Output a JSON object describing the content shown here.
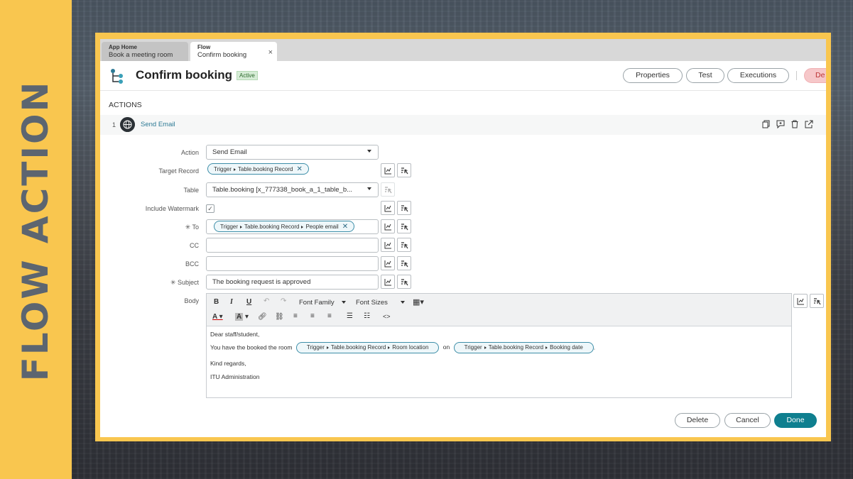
{
  "banner": {
    "text": "FLOW ACTION"
  },
  "tabs": [
    {
      "app": "App Home",
      "label": "Book a meeting room"
    },
    {
      "app": "Flow",
      "label": "Confirm booking",
      "close": "×"
    }
  ],
  "header": {
    "title": "Confirm booking",
    "status": "Active",
    "buttons": {
      "properties": "Properties",
      "test": "Test",
      "executions": "Executions",
      "delete": "De"
    }
  },
  "actions": {
    "section_label": "ACTIONS",
    "number": "1",
    "name": "Send Email",
    "row_icons": [
      "copy-icon",
      "comment-icon",
      "trash-icon",
      "open-external-icon"
    ]
  },
  "form": {
    "action": {
      "label": "Action",
      "value": "Send Email"
    },
    "target_record": {
      "label": "Target Record",
      "pill": [
        "Trigger",
        "Table.booking Record"
      ]
    },
    "table": {
      "label": "Table",
      "value": "Table.booking [x_777338_book_a_1_table_b..."
    },
    "include_watermark": {
      "label": "Include Watermark",
      "checked": "✓"
    },
    "to": {
      "label": "✳ To",
      "pill": [
        "Trigger",
        "Table.booking Record",
        "People email"
      ]
    },
    "cc": {
      "label": "CC",
      "value": ""
    },
    "bcc": {
      "label": "BCC",
      "value": ""
    },
    "subject": {
      "label": "✳ Subject",
      "value": "The booking request is approved"
    },
    "body": {
      "label": "Body",
      "toolbar": {
        "font_family": "Font Family",
        "font_sizes": "Font Sizes"
      },
      "lines": {
        "greeting": "Dear staff/student,",
        "sentence_start": "You have the booked the room",
        "connector": "on",
        "end": ".",
        "pill1": [
          "Trigger",
          "Table.booking Record",
          "Room location"
        ],
        "pill2": [
          "Trigger",
          "Table.booking Record",
          "Booking date"
        ],
        "closing": "Kind regards,",
        "signature": "ITU Administration"
      }
    }
  },
  "footer": {
    "delete": "Delete",
    "cancel": "Cancel",
    "done": "Done"
  },
  "colors": {
    "banner": "#f9c64f",
    "accent": "#0f7f8f",
    "link": "#2d7a95"
  }
}
